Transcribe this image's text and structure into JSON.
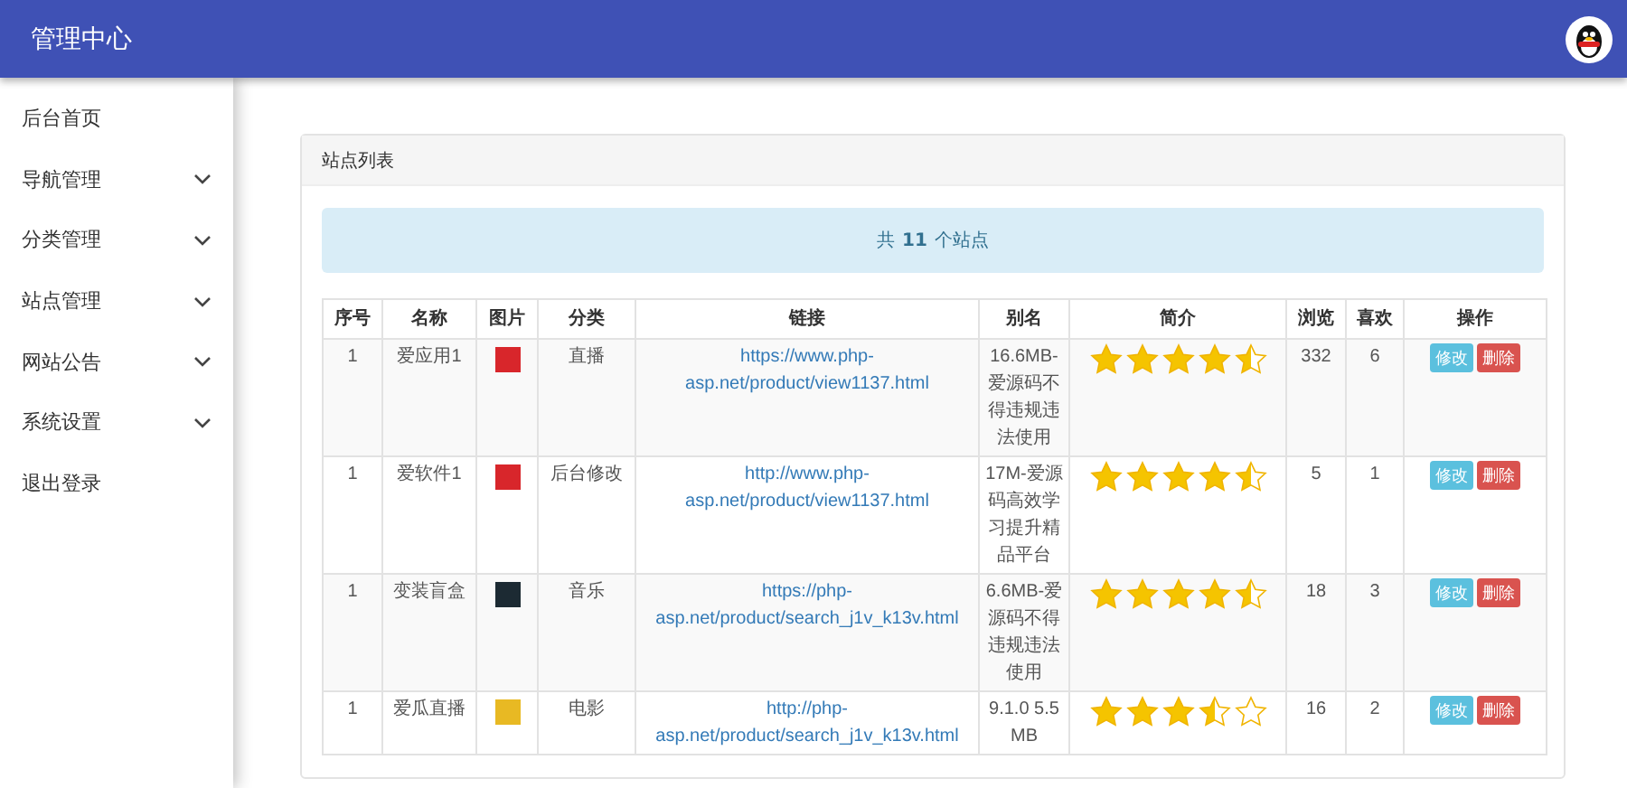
{
  "header": {
    "title": "管理中心"
  },
  "sidebar": {
    "items": [
      {
        "label": "后台首页",
        "kind": "link"
      },
      {
        "label": "导航管理",
        "kind": "menu"
      },
      {
        "label": "分类管理",
        "kind": "menu"
      },
      {
        "label": "站点管理",
        "kind": "menu"
      },
      {
        "label": "网站公告",
        "kind": "menu"
      },
      {
        "label": "系统设置",
        "kind": "menu"
      },
      {
        "label": "退出登录",
        "kind": "link"
      }
    ]
  },
  "panel": {
    "title": "站点列表",
    "summary": "共 **11** 个站点",
    "table": {
      "columns": [
        "序号",
        "名称",
        "图片",
        "分类",
        "链接",
        "别名",
        "简介",
        "浏览",
        "喜欢",
        "操作"
      ],
      "rows": [
        {
          "index": "1",
          "name": "爱应用1",
          "image": {
            "color": "#d8262b"
          },
          "category": "直播",
          "link": "https://www.php-asp.net/product/view1137.html",
          "alias": "16.6MB-爱源码不得违规违法使用",
          "stars": 4.5,
          "views": "332",
          "likes": "6",
          "actions": [
            "修改",
            "删除"
          ]
        },
        {
          "index": "1",
          "name": "爱软件1",
          "image": {
            "color": "#d8262b"
          },
          "category": "后台修改",
          "link": "http://www.php-asp.net/product/view1137.html",
          "alias": "17M-爱源码高效学习提升精品平台",
          "stars": 4.5,
          "views": "5",
          "likes": "1",
          "actions": [
            "修改",
            "删除"
          ]
        },
        {
          "index": "1",
          "name": "变装盲盒",
          "image": {
            "color": "#1c2a33"
          },
          "category": "音乐",
          "link": "https://php-asp.net/product/search_j1v_k13v.html",
          "alias": "6.6MB-爱源码不得违规违法使用",
          "stars": 4.5,
          "views": "18",
          "likes": "3",
          "actions": [
            "修改",
            "删除"
          ]
        },
        {
          "index": "1",
          "name": "爱瓜直播",
          "image": {
            "color": "#e8b923"
          },
          "category": "电影",
          "link": "http://php-asp.net/product/search_j1v_k13v.html",
          "alias": "9.1.0 5.5MB",
          "stars": 3.5,
          "views": "16",
          "likes": "2",
          "actions": [
            "修改",
            "删除"
          ]
        }
      ]
    }
  }
}
